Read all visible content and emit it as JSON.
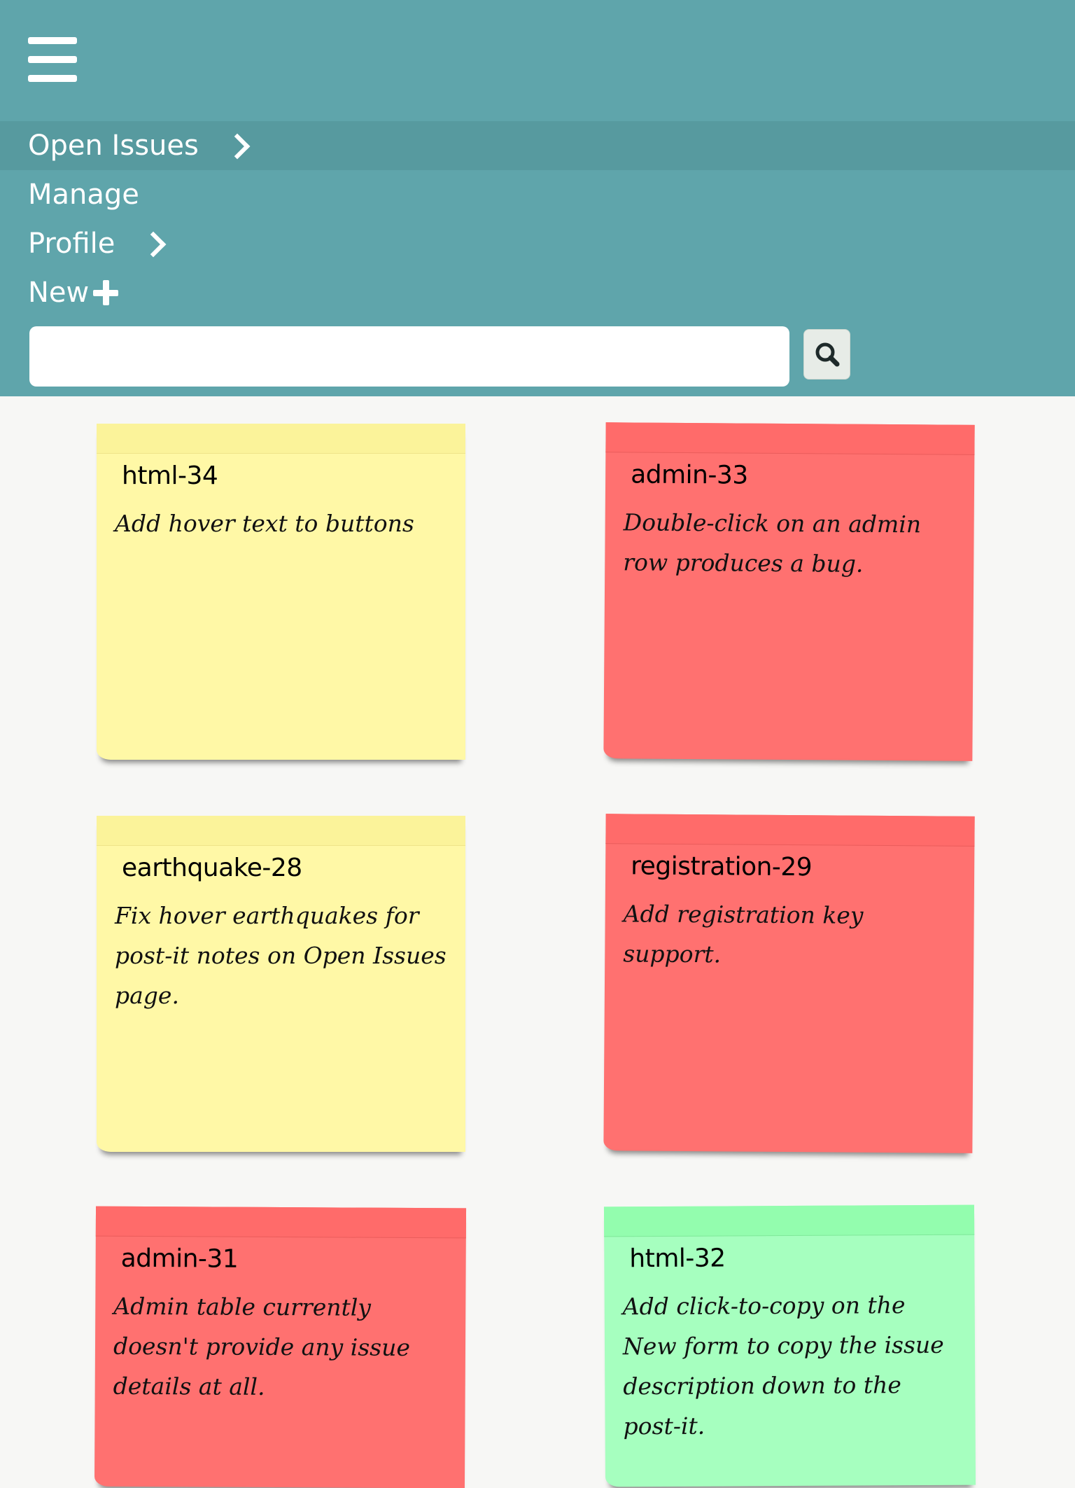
{
  "nav": {
    "items": [
      {
        "label": "Open Issues"
      },
      {
        "label": "Manage"
      },
      {
        "label": "Profile"
      },
      {
        "label": "New"
      }
    ]
  },
  "search": {
    "value": "",
    "placeholder": ""
  },
  "notes": [
    {
      "id": "html-34",
      "description": "Add hover text to buttons",
      "color": "#fff8a6"
    },
    {
      "id": "admin-33",
      "description": "Double-click on an admin row produces a bug.",
      "color": "#ff7170"
    },
    {
      "id": "earthquake-28",
      "description": "Fix hover earthquakes for post-it notes on Open Issues page.",
      "color": "#fff8a6"
    },
    {
      "id": "registration-29",
      "description": "Add registration key support.",
      "color": "#ff7170"
    },
    {
      "id": "admin-31",
      "description": "Admin table currently doesn't provide any issue details at all.",
      "color": "#ff7170"
    },
    {
      "id": "html-32",
      "description": "Add click-to-copy on the New form to copy the issue description down to the post-it.",
      "color": "#a6ffbf"
    }
  ],
  "colors": {
    "topbar": "#5fa5ab",
    "nav_active": "#579a9f",
    "page_background": "#f7f7f5"
  },
  "icons": {
    "menu": "hamburger-icon",
    "chevron": "chevron-right-icon",
    "add": "plus-icon",
    "search": "search-icon"
  }
}
